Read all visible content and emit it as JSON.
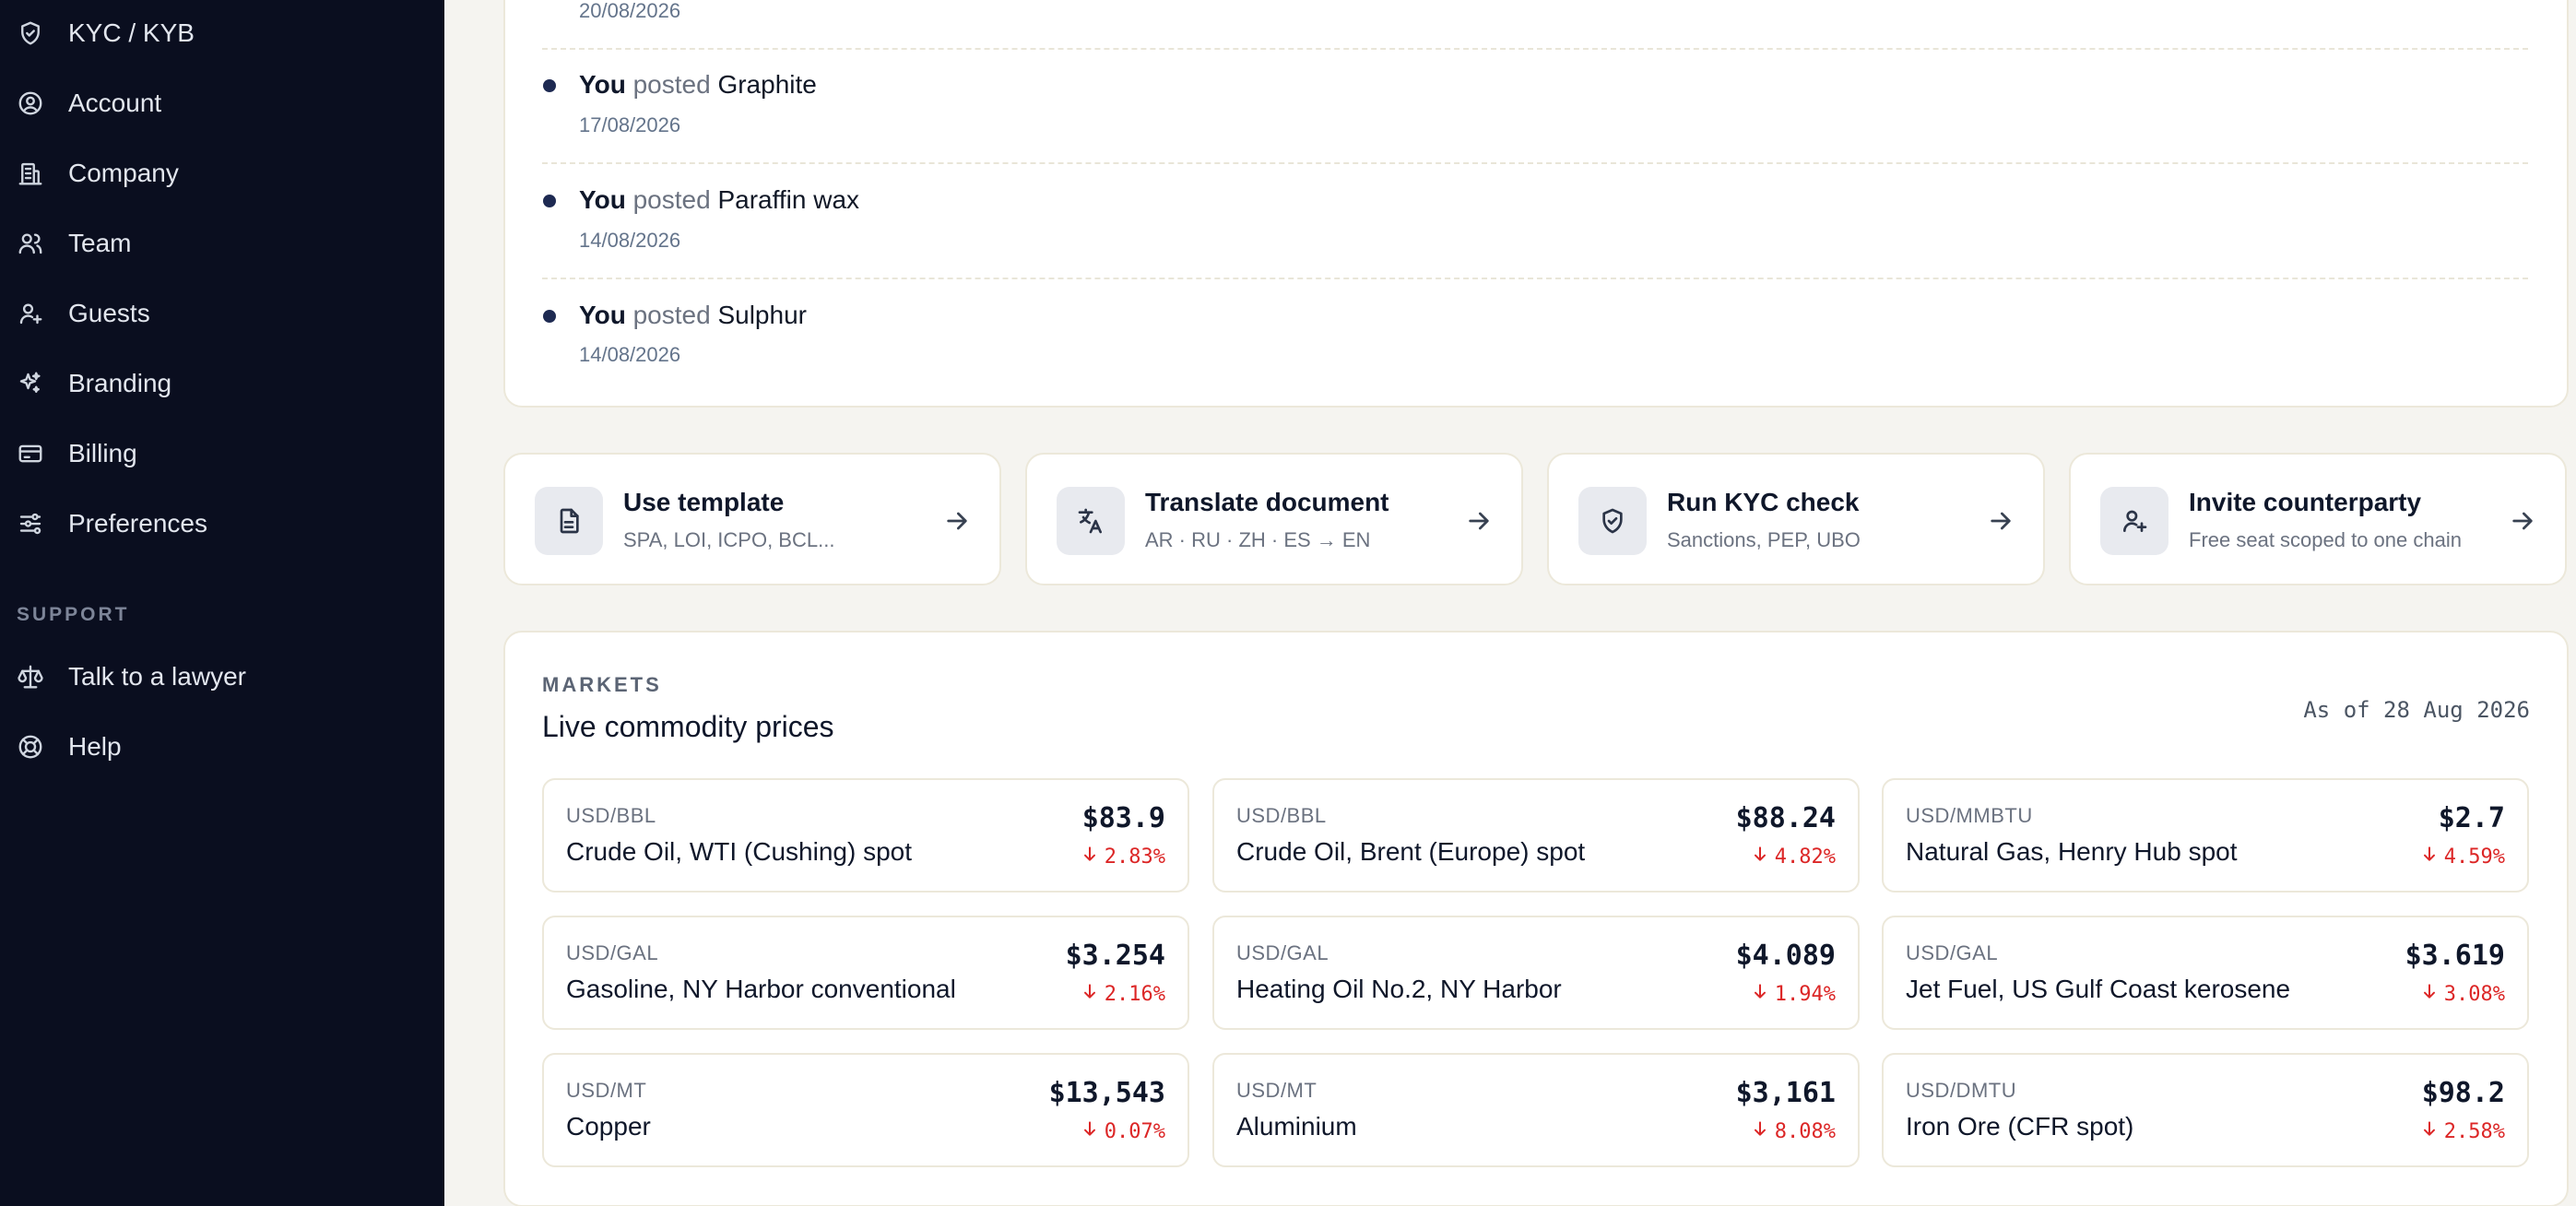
{
  "sidebar": {
    "items": [
      {
        "label": "KYC / KYB",
        "icon": "shield-check-icon"
      },
      {
        "label": "Account",
        "icon": "user-circle-icon"
      },
      {
        "label": "Company",
        "icon": "building-icon"
      },
      {
        "label": "Team",
        "icon": "users-icon"
      },
      {
        "label": "Guests",
        "icon": "user-plus-icon"
      },
      {
        "label": "Branding",
        "icon": "sparkles-icon"
      },
      {
        "label": "Billing",
        "icon": "credit-card-icon"
      },
      {
        "label": "Preferences",
        "icon": "sliders-icon"
      }
    ],
    "support_label": "SUPPORT",
    "support_items": [
      {
        "label": "Talk to a lawyer",
        "icon": "scale-icon"
      },
      {
        "label": "Help",
        "icon": "lifebuoy-icon"
      }
    ]
  },
  "activity": {
    "top_date": "20/08/2026",
    "items": [
      {
        "actor": "You",
        "verb": "posted",
        "object": "Graphite",
        "date": "17/08/2026"
      },
      {
        "actor": "You",
        "verb": "posted",
        "object": "Paraffin wax",
        "date": "14/08/2026"
      },
      {
        "actor": "You",
        "verb": "posted",
        "object": "Sulphur",
        "date": "14/08/2026"
      }
    ]
  },
  "actions": [
    {
      "title": "Use template",
      "sub": "SPA, LOI, ICPO, BCL...",
      "icon": "document-icon"
    },
    {
      "title": "Translate document",
      "sub": "AR · RU · ZH · ES → EN",
      "icon": "translate-icon"
    },
    {
      "title": "Run KYC check",
      "sub": "Sanctions, PEP, UBO",
      "icon": "shield-check-icon"
    },
    {
      "title": "Invite counterparty",
      "sub": "Free seat scoped to one chain",
      "icon": "user-plus-icon"
    }
  ],
  "markets": {
    "kicker": "MARKETS",
    "title": "Live commodity prices",
    "as_of": "As of 28 Aug 2026",
    "down_color": "#dc2626",
    "tiles": [
      {
        "unit": "USD/BBL",
        "name": "Crude Oil, WTI (Cushing) spot",
        "price": "$83.9",
        "change": "2.83%"
      },
      {
        "unit": "USD/BBL",
        "name": "Crude Oil, Brent (Europe) spot",
        "price": "$88.24",
        "change": "4.82%"
      },
      {
        "unit": "USD/MMBTU",
        "name": "Natural Gas, Henry Hub spot",
        "price": "$2.7",
        "change": "4.59%"
      },
      {
        "unit": "USD/GAL",
        "name": "Gasoline, NY Harbor conventional",
        "price": "$3.254",
        "change": "2.16%"
      },
      {
        "unit": "USD/GAL",
        "name": "Heating Oil No.2, NY Harbor",
        "price": "$4.089",
        "change": "1.94%"
      },
      {
        "unit": "USD/GAL",
        "name": "Jet Fuel, US Gulf Coast kerosene",
        "price": "$3.619",
        "change": "3.08%"
      },
      {
        "unit": "USD/MT",
        "name": "Copper",
        "price": "$13,543",
        "change": "0.07%"
      },
      {
        "unit": "USD/MT",
        "name": "Aluminium",
        "price": "$3,161",
        "change": "8.08%"
      },
      {
        "unit": "USD/DMTU",
        "name": "Iron Ore (CFR spot)",
        "price": "$98.2",
        "change": "2.58%"
      }
    ]
  }
}
